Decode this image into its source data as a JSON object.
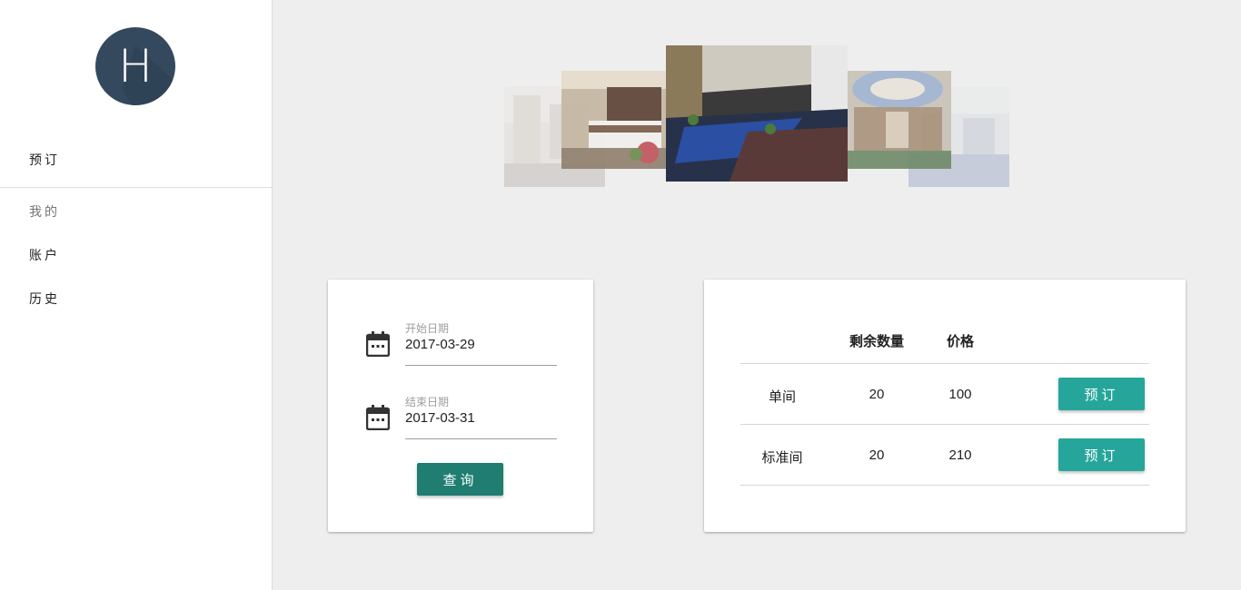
{
  "sidebar": {
    "avatar_letter": "H",
    "items": [
      {
        "label": "预订"
      },
      {
        "label": "我的"
      },
      {
        "label": "账户"
      },
      {
        "label": "历史"
      }
    ]
  },
  "carousel": {
    "slides": [
      "lobby-photo",
      "hotel-room-photo",
      "grand-hall-photo",
      "atrium-photo",
      "lounge-photo"
    ]
  },
  "search": {
    "start": {
      "label": "开始日期",
      "value": "2017-03-29"
    },
    "end": {
      "label": "结束日期",
      "value": "2017-03-31"
    },
    "query_label": "查询"
  },
  "rooms": {
    "headers": {
      "remaining": "剩余数量",
      "price": "价格"
    },
    "rows": [
      {
        "type": "单间",
        "remaining": "20",
        "price": "100",
        "action": "预订"
      },
      {
        "type": "标准间",
        "remaining": "20",
        "price": "210",
        "action": "预订"
      }
    ]
  },
  "colors": {
    "avatar": "#34495e",
    "query_button": "#1f7d71",
    "book_button": "#26a69a",
    "background": "#eeeeee"
  }
}
